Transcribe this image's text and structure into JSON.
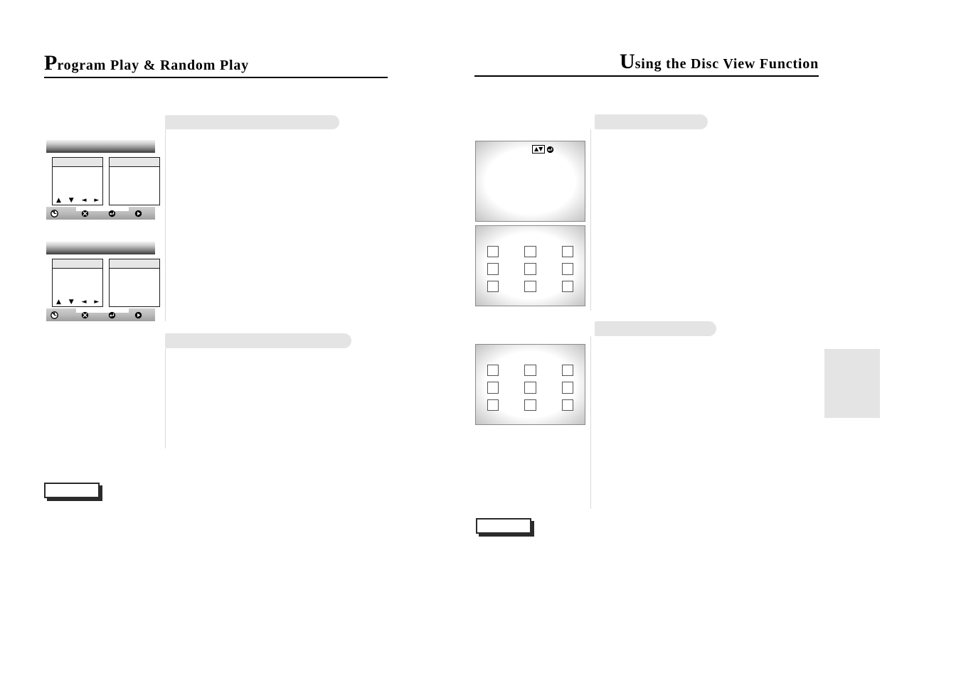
{
  "document": {
    "type": "manual-spread",
    "background": "#ffffff",
    "accent_gray": "#e4e4e4",
    "ink": "#000000"
  },
  "left_page": {
    "heading": {
      "drop_cap": "P",
      "rest": "rogram Play & Random Play"
    },
    "sections": [
      {
        "id": "program-play",
        "label": ""
      },
      {
        "id": "random-play",
        "label": ""
      }
    ],
    "osd_mockups": [
      {
        "id": "program-play-menu",
        "title": "",
        "left_panel": {
          "header": "",
          "rows": []
        },
        "right_panel": {
          "header": "",
          "rows": []
        },
        "arrows": "▲ ▼ ◄ ►",
        "footer_icons": [
          "repeat-icon",
          "cancel-icon",
          "enter-icon",
          "play-icon"
        ]
      },
      {
        "id": "random-play-menu",
        "title": "",
        "left_panel": {
          "header": "",
          "rows": []
        },
        "right_panel": {
          "header": "",
          "rows": []
        },
        "arrows": "▲ ▼ ◄ ►",
        "footer_icons": [
          "repeat-icon",
          "cancel-icon",
          "enter-icon",
          "play-icon"
        ]
      }
    ],
    "page_number": ""
  },
  "right_page": {
    "heading": {
      "drop_cap": "U",
      "rest": "sing the Disc View Function"
    },
    "sections": [
      {
        "id": "disc-view",
        "label": ""
      },
      {
        "id": "thumbnail-view",
        "label": ""
      }
    ],
    "tv_screens": [
      {
        "id": "blank-screen",
        "badge": {
          "arrows": "▲▼",
          "enter_icon": "enter-icon"
        },
        "cells": 0
      },
      {
        "id": "thumbnail-grid-1",
        "badge": null,
        "cells": 9
      },
      {
        "id": "thumbnail-grid-2",
        "badge": null,
        "cells": 9
      }
    ],
    "page_number": "",
    "edge_tab": ""
  }
}
